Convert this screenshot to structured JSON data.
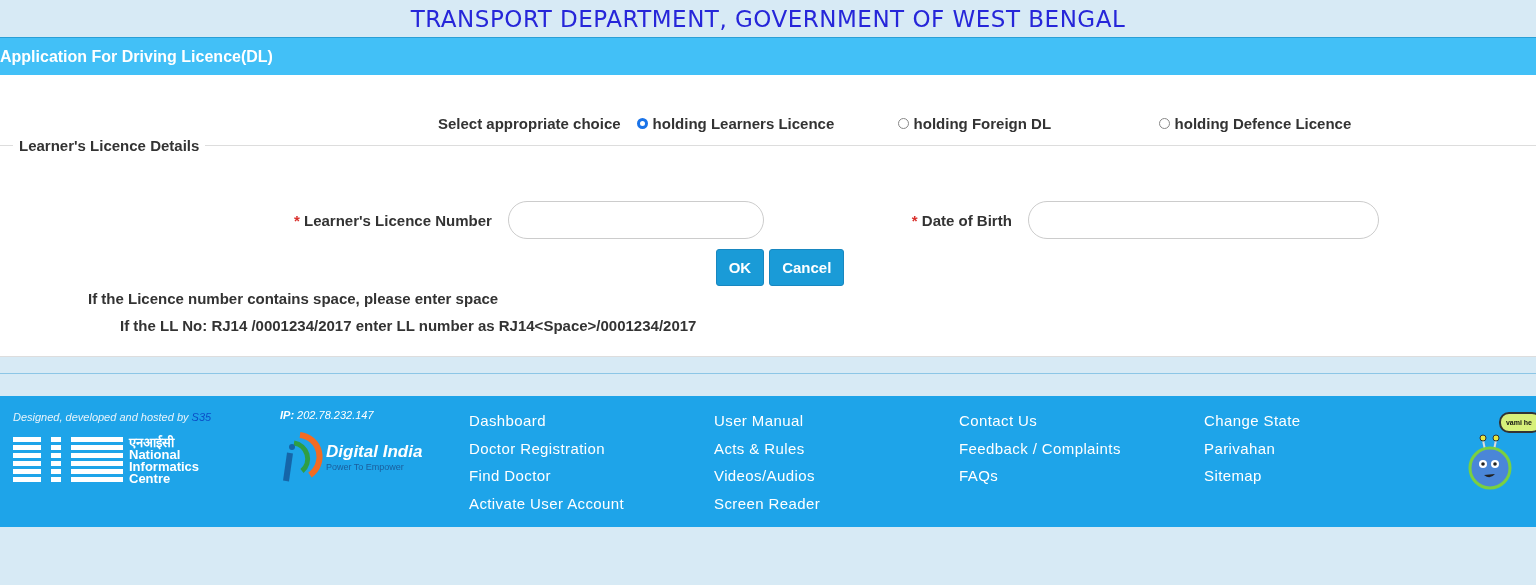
{
  "header": {
    "title": "TRANSPORT DEPARTMENT, GOVERNMENT OF WEST BENGAL"
  },
  "section_bar": {
    "title": "Application For Driving Licence(DL)"
  },
  "choice": {
    "label": "Select appropriate choice",
    "options": [
      {
        "label": "holding Learners Licence",
        "selected": true
      },
      {
        "label": "holding Foreign DL",
        "selected": false
      },
      {
        "label": "holding Defence Licence",
        "selected": false
      }
    ]
  },
  "fieldset": {
    "legend": "Learner's Licence Details",
    "fields": [
      {
        "required_mark": "*",
        "label": "Learner's Licence Number"
      },
      {
        "required_mark": "*",
        "label": "Date of Birth"
      }
    ],
    "buttons": [
      "OK",
      "Cancel"
    ],
    "notes": [
      "If the Licence number contains space, please enter space",
      "If the LL No: RJ14 /0001234/2017 enter LL number as RJ14<Space>/0001234/2017"
    ]
  },
  "footer": {
    "credit": "Designed, developed and hosted by",
    "credit_link": "S35",
    "ip_label": "IP:",
    "ip_value": "202.78.232.147",
    "nic_logo": {
      "hindi": "एनआईसी",
      "lines": [
        "National",
        "Informatics",
        "Centre"
      ]
    },
    "digital_india_logo": {
      "title": "Digital India",
      "tagline": "Power To Empower"
    },
    "link_columns": [
      [
        "Dashboard",
        "Doctor Registration",
        "Find Doctor",
        "Activate User Account"
      ],
      [
        "User Manual",
        "Acts & Rules",
        "Videos/Audios",
        "Screen Reader"
      ],
      [
        "Contact Us",
        "Feedback / Complaints",
        "FAQs"
      ],
      [
        "Change State",
        "Parivahan",
        "Sitemap"
      ]
    ],
    "chatbot_bubble": "vami he"
  }
}
